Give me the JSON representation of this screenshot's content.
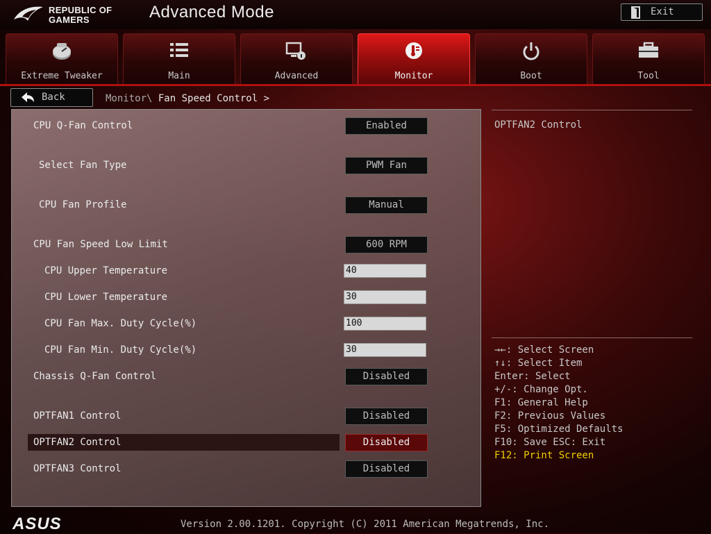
{
  "header": {
    "logo_text_line1": "REPUBLIC OF",
    "logo_text_line2": "GAMERS",
    "title": "Advanced Mode",
    "exit_label": "Exit"
  },
  "tabs": [
    {
      "label": "Extreme Tweaker",
      "icon": "gauge-icon",
      "active": false
    },
    {
      "label": "Main",
      "icon": "list-icon",
      "active": false
    },
    {
      "label": "Advanced",
      "icon": "settings-icon",
      "active": false
    },
    {
      "label": "Monitor",
      "icon": "monitor-thermometer-icon",
      "active": true
    },
    {
      "label": "Boot",
      "icon": "power-icon",
      "active": false
    },
    {
      "label": "Tool",
      "icon": "toolbox-icon",
      "active": false
    }
  ],
  "nav": {
    "back_label": "Back",
    "breadcrumb_parent": "Monitor\\",
    "breadcrumb_current": "Fan Speed Control >"
  },
  "settings": [
    {
      "label": "CPU Q-Fan Control",
      "value": "Enabled",
      "type": "select"
    },
    {
      "label": "Select Fan Type",
      "value": "PWM Fan",
      "type": "select"
    },
    {
      "label": "CPU Fan Profile",
      "value": "Manual",
      "type": "select"
    },
    {
      "label": "CPU Fan Speed Low Limit",
      "value": "600 RPM",
      "type": "select"
    },
    {
      "label": "CPU Upper Temperature",
      "value": "40",
      "type": "number"
    },
    {
      "label": "CPU Lower Temperature",
      "value": "30",
      "type": "number"
    },
    {
      "label": "CPU Fan Max. Duty Cycle(%)",
      "value": "100",
      "type": "number"
    },
    {
      "label": "CPU Fan Min. Duty Cycle(%)",
      "value": "30",
      "type": "number"
    },
    {
      "label": "Chassis Q-Fan Control",
      "value": "Disabled",
      "type": "select"
    },
    {
      "label": "OPTFAN1 Control",
      "value": "Disabled",
      "type": "select"
    },
    {
      "label": "OPTFAN2 Control",
      "value": "Disabled",
      "type": "select",
      "selected": true
    },
    {
      "label": "OPTFAN3 Control",
      "value": "Disabled",
      "type": "select"
    }
  ],
  "help": {
    "title": "OPTFAN2 Control",
    "keys": [
      "→←: Select Screen",
      "↑↓: Select Item",
      "Enter: Select",
      "+/-: Change Opt.",
      "F1: General Help",
      "F2: Previous Values",
      "F5: Optimized Defaults",
      "F10: Save  ESC: Exit",
      "F12: Print Screen"
    ]
  },
  "footer": {
    "brand": "ASUS",
    "version": "Version 2.00.1201. Copyright (C) 2011 American Megatrends, Inc."
  },
  "colors": {
    "accent_red": "#e01818",
    "selected_value_bg": "#5a0808",
    "highlight_key": "#f0d000"
  }
}
